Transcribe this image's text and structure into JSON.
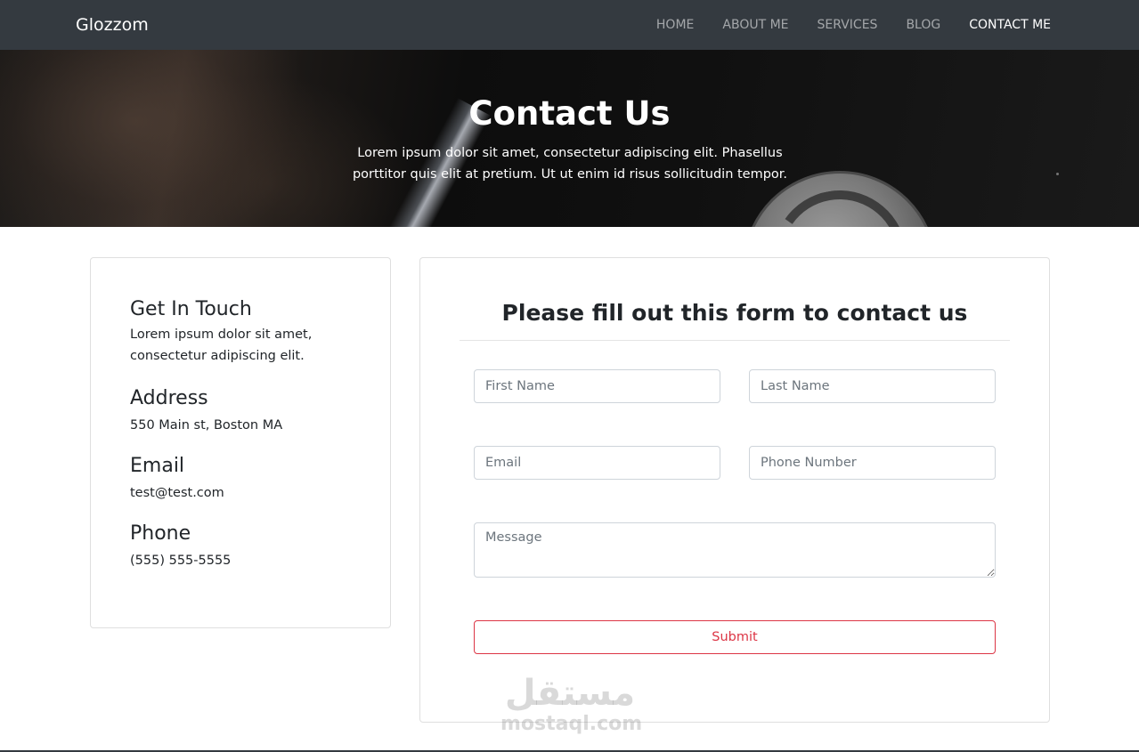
{
  "navbar": {
    "brand": "Glozzom",
    "links": [
      {
        "label": "HOME",
        "active": false
      },
      {
        "label": "ABOUT ME",
        "active": false
      },
      {
        "label": "SERVICES",
        "active": false
      },
      {
        "label": "BLOG",
        "active": false
      },
      {
        "label": "CONTACT ME",
        "active": true
      }
    ]
  },
  "hero": {
    "title": "Contact Us",
    "text": "Lorem ipsum dolor sit amet, consectetur adipiscing elit. Phasellus porttitor quis elit at pretium. Ut ut enim id risus sollicitudin tempor."
  },
  "info": {
    "get_in_touch": {
      "heading": "Get In Touch",
      "text": "Lorem ipsum dolor sit amet, consectetur adipiscing elit."
    },
    "address": {
      "heading": "Address",
      "text": "550 Main st, Boston MA"
    },
    "email": {
      "heading": "Email",
      "text": "test@test.com"
    },
    "phone": {
      "heading": "Phone",
      "text": "(555) 555-5555"
    }
  },
  "form": {
    "title": "Please fill out this form to contact us",
    "first_name": {
      "placeholder": "First Name",
      "value": ""
    },
    "last_name": {
      "placeholder": "Last Name",
      "value": ""
    },
    "email": {
      "placeholder": "Email",
      "value": ""
    },
    "phone": {
      "placeholder": "Phone Number",
      "value": ""
    },
    "message": {
      "placeholder": "Message",
      "value": ""
    },
    "submit_label": "Submit"
  },
  "watermark": {
    "logo_text": "مستقل",
    "text": "mostaql.com"
  },
  "colors": {
    "navbar_bg": "#343a40",
    "submit_accent": "#dc3545",
    "text": "#212529",
    "border": "#ced4da"
  },
  "icons": []
}
